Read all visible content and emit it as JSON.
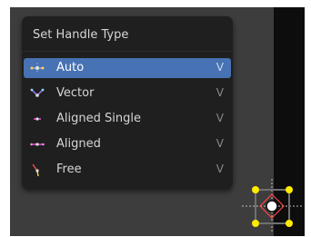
{
  "menu": {
    "title": "Set Handle Type",
    "items": [
      {
        "label": "Auto",
        "shortcut": "V",
        "icon": "handle-auto-icon",
        "active": true
      },
      {
        "label": "Vector",
        "shortcut": "V",
        "icon": "handle-vector-icon",
        "active": false
      },
      {
        "label": "Aligned Single",
        "shortcut": "V",
        "icon": "handle-aligned-single-icon",
        "active": false
      },
      {
        "label": "Aligned",
        "shortcut": "V",
        "icon": "handle-aligned-icon",
        "active": false
      },
      {
        "label": "Free",
        "shortcut": "V",
        "icon": "handle-free-icon",
        "active": false
      }
    ]
  },
  "colors": {
    "menu_bg": "#1f1f1f",
    "highlight": "#4772b3",
    "viewport_bg": "#3d3d3d",
    "handle_yellow": "#ffec00",
    "handle_red": "#ff4040"
  }
}
